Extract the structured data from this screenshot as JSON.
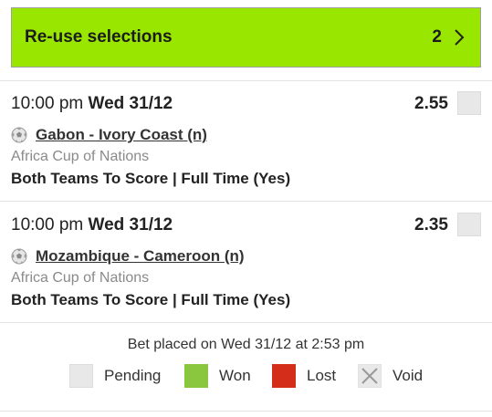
{
  "reuse": {
    "label": "Re-use selections",
    "count": "2",
    "icon": "chevron-right-icon",
    "color": "#99e600"
  },
  "selections": [
    {
      "time": "10:00 pm",
      "date": "Wed 31/12",
      "odds": "2.55",
      "status": "Pending",
      "event": "Gabon - Ivory Coast (n)",
      "league": "Africa Cup of Nations",
      "market": "Both Teams To Score | Full Time (Yes)",
      "sport_icon": "football-icon"
    },
    {
      "time": "10:00 pm",
      "date": "Wed 31/12",
      "odds": "2.35",
      "status": "Pending",
      "event": "Mozambique - Cameroon (n)",
      "league": "Africa Cup of Nations",
      "market": "Both Teams To Score | Full Time (Yes)",
      "sport_icon": "football-icon"
    }
  ],
  "bet_placed": "Bet placed on Wed 31/12 at 2:53 pm",
  "legend": [
    {
      "label": "Pending",
      "color": "#e8e8e8"
    },
    {
      "label": "Won",
      "color": "#8bc63f"
    },
    {
      "label": "Lost",
      "color": "#d42d1a"
    },
    {
      "label": "Void",
      "color": "#e8e8e8",
      "icon": "cross-icon"
    }
  ]
}
